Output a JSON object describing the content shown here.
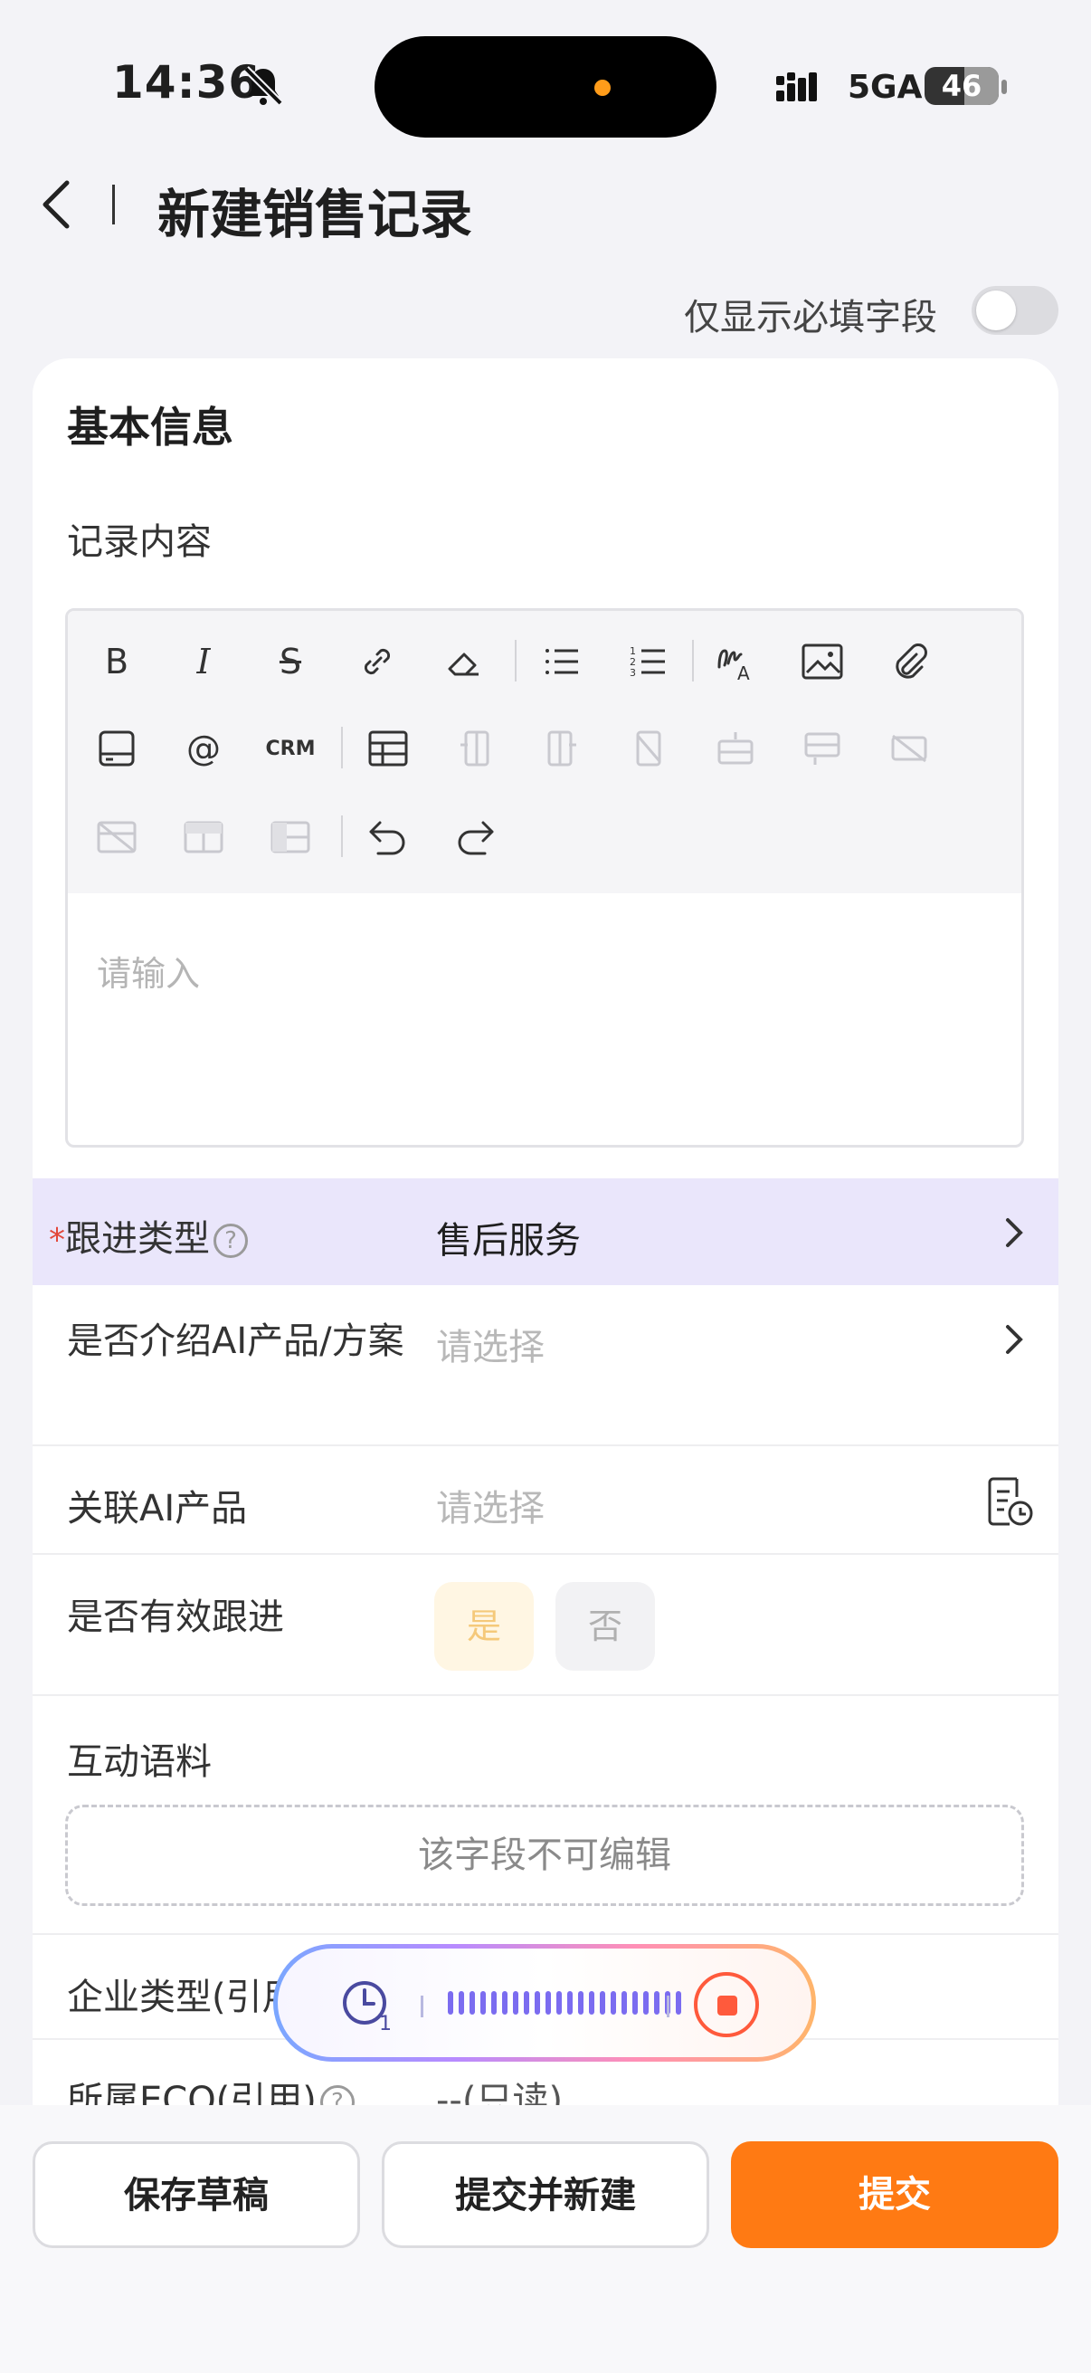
{
  "status_bar": {
    "time": "14:36",
    "network": "5GA",
    "battery": "46"
  },
  "header": {
    "title": "新建销售记录"
  },
  "filter": {
    "label": "仅显示必填字段",
    "enabled": false
  },
  "basic": {
    "title": "基本信息",
    "record_label": "记录内容",
    "crm_label": "CRM",
    "editor_placeholder": "请输入"
  },
  "fields": {
    "followup_type": {
      "required_mark": "*",
      "label": "跟进类型",
      "help": "?",
      "value": "售后服务"
    },
    "intro_ai": {
      "label": "是否介绍AI产品/方案",
      "placeholder": "请选择"
    },
    "related_ai": {
      "label": "关联AI产品",
      "placeholder": "请选择"
    },
    "effective": {
      "label": "是否有效跟进",
      "yes": "是",
      "no": "否"
    },
    "corpus": {
      "label": "互动语料",
      "note": "该字段不可编辑"
    },
    "company_type": {
      "label": "企业类型(引用)"
    },
    "eco": {
      "label": "所属ECO(引用)",
      "help": "?",
      "value": "--(只读)"
    }
  },
  "actions": {
    "save_draft": "保存草稿",
    "submit_new": "提交并新建",
    "submit": "提交"
  },
  "colors": {
    "accent": "#ff7a13",
    "highlight_row": "#eae6fb",
    "yes_pill": "#fff6e3"
  }
}
